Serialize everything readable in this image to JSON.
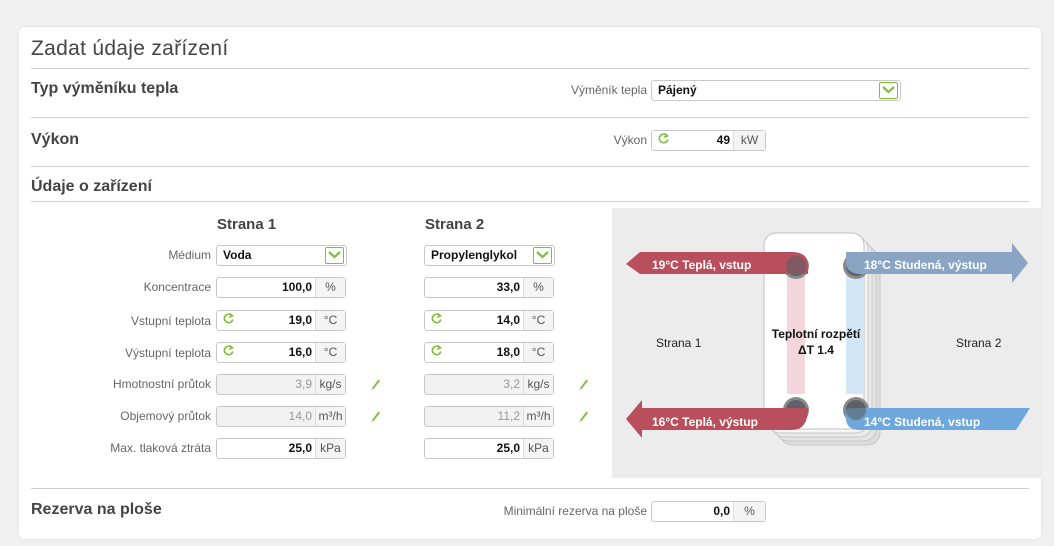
{
  "title": "Zadat údaje zařízení",
  "exchanger_type": {
    "section": "Typ výměníku tepla",
    "label": "Výměník tepla",
    "value": "Pájený"
  },
  "power": {
    "section": "Výkon",
    "label": "Výkon",
    "value": "49",
    "unit": "kW"
  },
  "equipment": {
    "section": "Údaje o zařízení",
    "side1_title": "Strana 1",
    "side2_title": "Strana 2",
    "labels": {
      "medium": "Médium",
      "concentration": "Koncentrace",
      "inlet_temp": "Vstupní teplota",
      "outlet_temp": "Výstupní teplota",
      "mass_flow": "Hmotnostní průtok",
      "volume_flow": "Objemový průtok",
      "max_pressure_drop": "Max. tlaková ztráta"
    },
    "side1": {
      "medium": "Voda",
      "concentration": "100,0",
      "concentration_unit": "%",
      "inlet_temp": "19,0",
      "inlet_temp_unit": "°C",
      "outlet_temp": "16,0",
      "outlet_temp_unit": "°C",
      "mass_flow": "3,9",
      "mass_flow_unit": "kg/s",
      "volume_flow": "14,0",
      "volume_flow_unit": "m³/h",
      "max_pressure_drop": "25,0",
      "max_pressure_drop_unit": "kPa"
    },
    "side2": {
      "medium": "Propylenglykol",
      "concentration": "33,0",
      "concentration_unit": "%",
      "inlet_temp": "14,0",
      "inlet_temp_unit": "°C",
      "outlet_temp": "18,0",
      "outlet_temp_unit": "°C",
      "mass_flow": "3,2",
      "mass_flow_unit": "kg/s",
      "volume_flow": "11,2",
      "volume_flow_unit": "m³/h",
      "max_pressure_drop": "25,0",
      "max_pressure_drop_unit": "kPa"
    }
  },
  "diagram": {
    "hot_in": "19°C Teplá, vstup",
    "hot_out": "16°C Teplá, výstup",
    "cold_out": "18°C Studená, výstup",
    "cold_in": "14°C Studená, vstup",
    "side1": "Strana 1",
    "side2": "Strana 2",
    "range_label": "Teplotní rozpětí",
    "range_value": "ΔT 1.4"
  },
  "reserve": {
    "section": "Rezerva na ploše",
    "label": "Minimální rezerva na ploše",
    "value": "0,0",
    "unit": "%"
  },
  "colors": {
    "accent": "#7cbf3a",
    "hot": "#b94e5d",
    "cold": "#6da7dc",
    "cold_out": "#8aa5c4"
  }
}
